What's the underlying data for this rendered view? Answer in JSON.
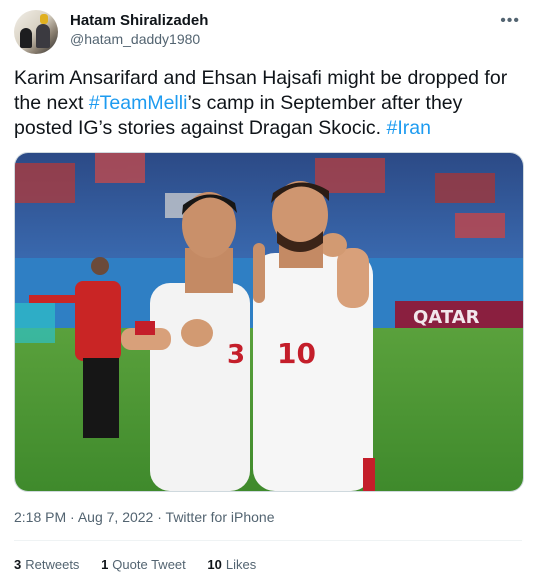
{
  "author": {
    "name": "Hatam Shiralizadeh",
    "handle": "@hatam_daddy1980"
  },
  "more_icon": "more-dots-icon",
  "tweet": {
    "text_1": "Karim Ansarifard and Ehsan Hajsafi might be dropped for the next ",
    "hashtag_1": "#TeamMelli",
    "text_2": "’s camp in September  after they posted IG’s stories against Dragan Skocic.  ",
    "hashtag_2": "#Iran"
  },
  "media": {
    "banner_text": "QATAR",
    "jersey_left_number": "3",
    "jersey_right_number": "10"
  },
  "meta": {
    "time": "2:18 PM",
    "date": "Aug 7, 2022",
    "source": "Twitter for iPhone",
    "separator": "·"
  },
  "stats": {
    "retweets_count": "3",
    "retweets_label": "Retweets",
    "quotes_count": "1",
    "quotes_label": "Quote Tweet",
    "likes_count": "10",
    "likes_label": "Likes"
  },
  "colors": {
    "link": "#1d9bf0",
    "text": "#0f1419",
    "muted": "#536471"
  }
}
